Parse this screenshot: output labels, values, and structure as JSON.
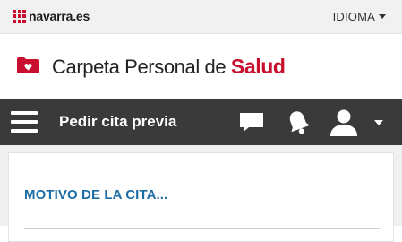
{
  "header": {
    "logo_text": "navarra.es",
    "language_label": "IDIOMA"
  },
  "brand": {
    "title_prefix": "Carpeta Personal de ",
    "title_accent": "Salud",
    "accent_color": "#c8102e"
  },
  "navbar": {
    "title": "Pedir cita previa",
    "background": "#3a3a3a",
    "icons": [
      "menu-icon",
      "chat-icon",
      "bell-icon",
      "user-icon",
      "chevron-down-icon"
    ]
  },
  "content": {
    "section_title": "MOTIVO DE LA CITA...",
    "title_color": "#1c6da4"
  }
}
